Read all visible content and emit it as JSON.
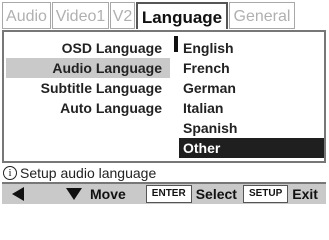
{
  "tabs": [
    {
      "label": "Audio",
      "active": false
    },
    {
      "label": "Video1",
      "active": false
    },
    {
      "label": "V2",
      "active": false
    },
    {
      "label": "Language",
      "active": true
    },
    {
      "label": "General",
      "active": false
    }
  ],
  "settings": [
    {
      "label": "OSD Language",
      "selected": false
    },
    {
      "label": "Audio Language",
      "selected": true
    },
    {
      "label": "Subtitle Language",
      "selected": false
    },
    {
      "label": "Auto Language",
      "selected": false
    }
  ],
  "options": [
    {
      "label": "English",
      "highlight": false
    },
    {
      "label": "French",
      "highlight": false
    },
    {
      "label": "German",
      "highlight": false
    },
    {
      "label": "Italian",
      "highlight": false
    },
    {
      "label": "Spanish",
      "highlight": false
    },
    {
      "label": "Other",
      "highlight": true
    }
  ],
  "info": {
    "icon": "i",
    "text": "Setup audio language"
  },
  "bar": {
    "move_label": "Move",
    "enter_key": "ENTER",
    "select_label": "Select",
    "setup_key": "SETUP",
    "exit_label": "Exit"
  },
  "colors": {
    "highlight_bg": "#1f1f1f",
    "selected_bg": "#c9c9c9",
    "bar_bg": "#c9c9c9"
  }
}
